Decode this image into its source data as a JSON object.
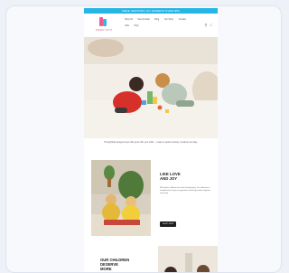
{
  "announcement": "FREE SHIPPING ON ORDERS OVER $50",
  "brand": {
    "name": "KIDDO TOYS"
  },
  "nav": {
    "items": [
      "Shop All",
      "New Arrivals",
      "Blog",
      "Our Story",
      "Contact"
    ],
    "row2": [
      "Gifts",
      "FAQ"
    ]
  },
  "header_icons": {
    "search": "search-icon",
    "cart": "cart-icon"
  },
  "intro": {
    "text": "Thoughtfully designed toys that grow with your child — made to spark curiosity, creativity and play."
  },
  "section1": {
    "title": "LIKE LOVE\nAND JOY",
    "body": "We believe children learn best through play. Our collection is handpicked to inspire imagination and bring families together every day.",
    "button": "SHOP NOW"
  },
  "section2": {
    "title": "OUR CHILDREN\nDESERVE\nMORE"
  },
  "colors": {
    "announcement_bg": "#25b6e6",
    "logo_pink": "#f05a8f",
    "logo_blue": "#2fb9e6",
    "button_bg": "#1f1f1f"
  }
}
